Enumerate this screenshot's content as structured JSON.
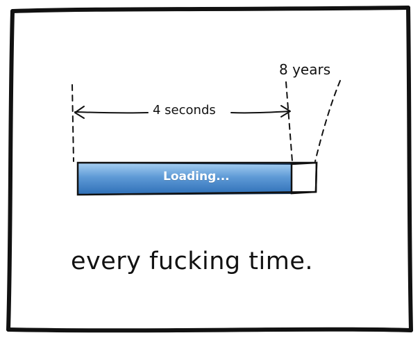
{
  "panel": {
    "duration_label": "8 years",
    "elapsed_label": "4 seconds",
    "progress_label": "Loading...",
    "caption": "every fucking time.",
    "progress_fraction": 0.9,
    "colors": {
      "frame": "#111111",
      "bar_fill_top": "#7FB2E5",
      "bar_fill_bottom": "#2E6FB7",
      "bar_empty": "#ffffff",
      "label_text": "#ffffff"
    }
  }
}
